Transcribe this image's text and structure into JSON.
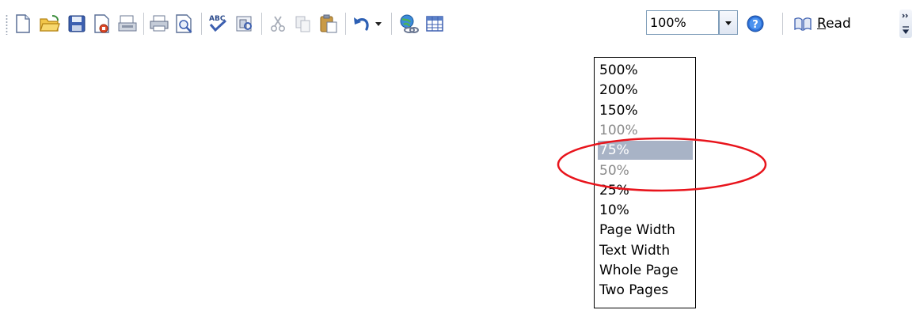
{
  "toolbar": {
    "buttons": [
      {
        "id": "new",
        "icon": "new-document-icon"
      },
      {
        "id": "open",
        "icon": "open-folder-icon"
      },
      {
        "id": "save",
        "icon": "save-disk-icon"
      },
      {
        "id": "permission",
        "icon": "permission-icon"
      },
      {
        "id": "email",
        "icon": "email-icon"
      },
      {
        "id": "print",
        "icon": "printer-icon"
      },
      {
        "id": "print-preview",
        "icon": "print-preview-icon"
      },
      {
        "id": "spelling",
        "icon": "spelling-grammar-icon"
      },
      {
        "id": "research",
        "icon": "research-icon"
      },
      {
        "id": "cut",
        "icon": "scissors-icon"
      },
      {
        "id": "copy",
        "icon": "copy-icon"
      },
      {
        "id": "paste",
        "icon": "paste-clipboard-icon"
      },
      {
        "id": "undo",
        "icon": "undo-arrow-icon"
      },
      {
        "id": "hyperlink",
        "icon": "hyperlink-globe-icon"
      },
      {
        "id": "table",
        "icon": "table-grid-icon"
      },
      {
        "id": "help",
        "icon": "help-icon"
      }
    ],
    "zoom_value": "100%",
    "read_label_first": "R",
    "read_label_rest": "ead",
    "accent": "#2c5fb4"
  },
  "zoom_menu": {
    "items": [
      {
        "label": "500%",
        "state": "normal"
      },
      {
        "label": "200%",
        "state": "normal"
      },
      {
        "label": "150%",
        "state": "normal"
      },
      {
        "label": "100%",
        "state": "dim"
      },
      {
        "label": "75%",
        "state": "selected"
      },
      {
        "label": "50%",
        "state": "dim"
      },
      {
        "label": "25%",
        "state": "normal"
      },
      {
        "label": "10%",
        "state": "normal"
      },
      {
        "label": "Page Width",
        "state": "normal"
      },
      {
        "label": "Text Width",
        "state": "normal"
      },
      {
        "label": "Whole Page",
        "state": "normal"
      },
      {
        "label": "Two Pages",
        "state": "normal"
      }
    ],
    "selected_bg": "#a8b3c6",
    "annotation_color": "#e8141c"
  }
}
